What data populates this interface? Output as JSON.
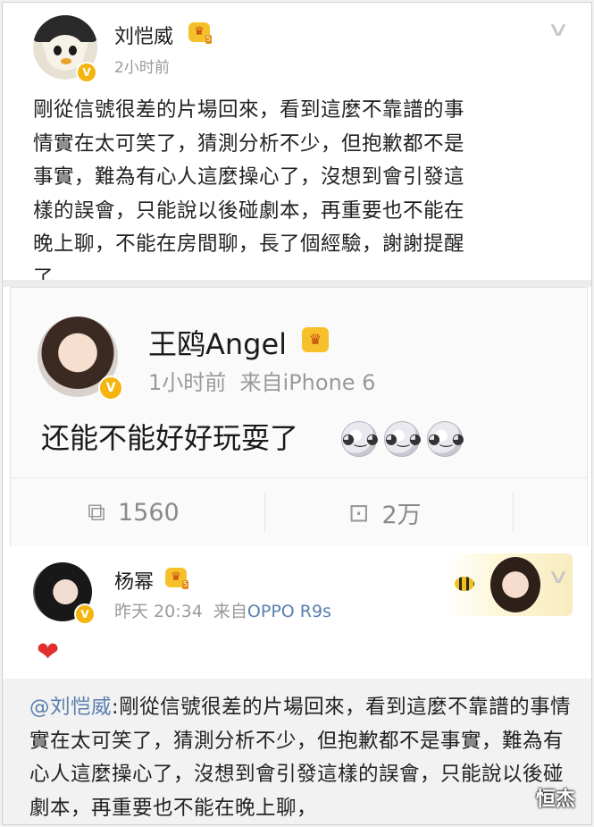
{
  "post1": {
    "author": "刘恺威",
    "time": "2小时前",
    "text": "剛從信號很差的片場回來，看到這麼不靠譜的事\n情實在太可笑了，猜測分析不少，但抱歉都不是\n事實，難為有心人這麼操心了，沒想到會引發這\n樣的誤會，只能說以後碰劇本，再重要也不能在\n晚上聊，不能在房間聊，長了個經驗，謝謝提醒\n了"
  },
  "post2": {
    "author": "王鸥Angel",
    "time": "1小时前",
    "source": "来自iPhone 6",
    "text": "还能不能好好玩耍了",
    "repost_count": "1560",
    "comment_count": "2万"
  },
  "post3": {
    "author": "杨幂",
    "time": "昨天 20:34",
    "source_prefix": "来自",
    "source": "OPPO R9s",
    "quote_mention": "@刘恺威",
    "quote_text": ":剛從信號很差的片場回來，看到這麼不靠譜的事情實在太可笑了，猜測分析不少，但抱歉都不是事實，難為有心人這麼操心了，沒想到會引發這樣的誤會，只能說以後碰劇本，再重要也不能在晚上聊，"
  },
  "watermark": "恒杰",
  "icons": {
    "verified": "verified-badge-icon",
    "vip": "vip-crown-icon",
    "menu": "chevron-down-icon",
    "repost": "share-icon",
    "comment": "comment-icon",
    "emoji": "crying-face-emoji",
    "heart": "heart-emoji"
  },
  "colors": {
    "link": "#5a7fb0",
    "verified": "#f5b50f",
    "heart": "#e0302d",
    "meta": "#9a9a9a"
  }
}
